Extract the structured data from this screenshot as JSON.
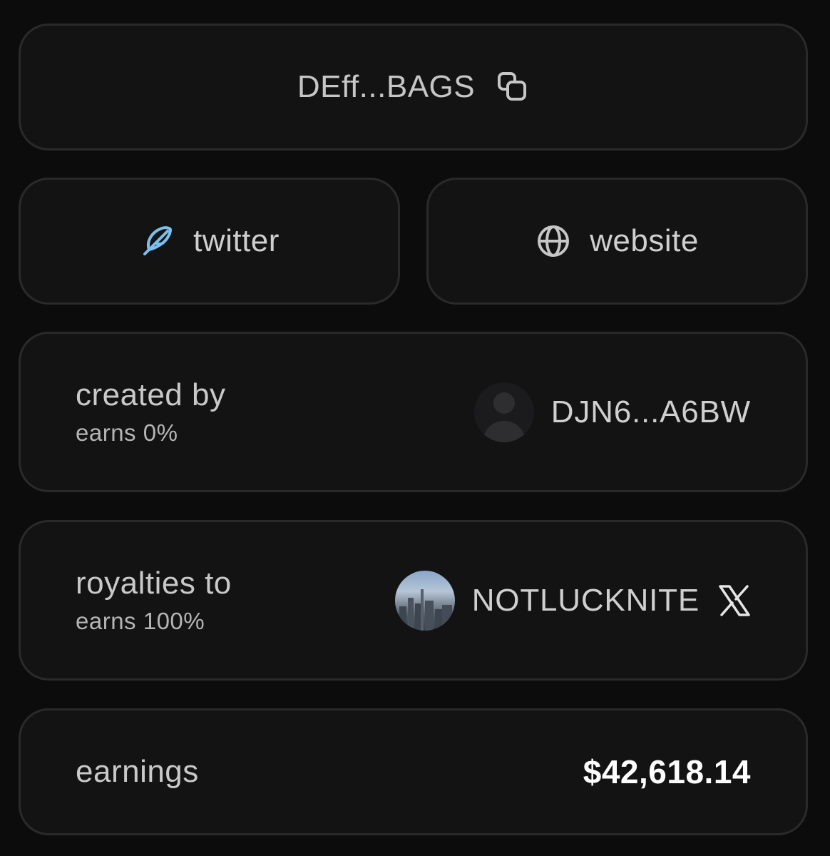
{
  "token": {
    "address_short": "DEff...BAGS",
    "copy_icon": "copy-icon"
  },
  "links": {
    "twitter": {
      "label": "twitter",
      "icon": "feather-icon",
      "icon_color": "#7cc0f0"
    },
    "website": {
      "label": "website",
      "icon": "globe-icon"
    }
  },
  "creator": {
    "title": "created by",
    "earns": "earns 0%",
    "account": "DJN6...A6BW",
    "avatar": "default-avatar"
  },
  "royalties": {
    "title": "royalties to",
    "earns": "earns 100%",
    "account": "NOTLUCKNITE",
    "avatar": "city-photo-avatar",
    "platform_icon": "x-logo-icon"
  },
  "earnings": {
    "label": "earnings",
    "value": "$42,618.14"
  },
  "colors": {
    "background": "#0c0c0d",
    "card": "#131314",
    "border": "#2a2a2c",
    "text": "#c9c9c9",
    "accent": "#7cc0f0"
  }
}
